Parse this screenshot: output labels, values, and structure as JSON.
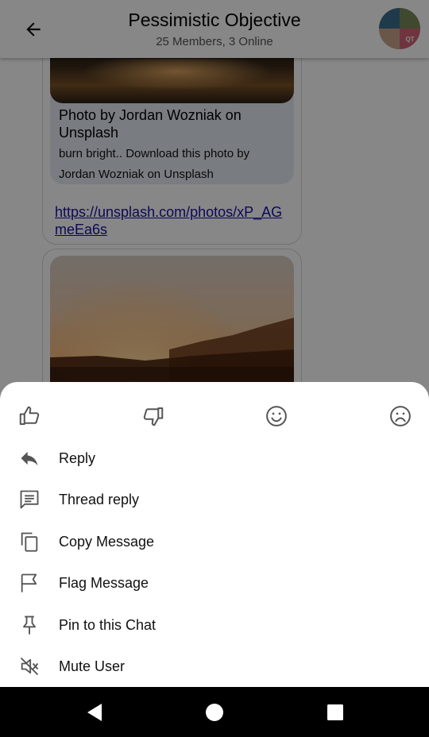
{
  "header": {
    "title": "Pessimistic Objective",
    "subtitle": "25 Members, 3 Online",
    "avatar_initials": "QT"
  },
  "messages": {
    "attachment": {
      "title": "Photo by Jordan Wozniak on Unsplash",
      "text": "burn bright.. Download this photo by Jordan Wozniak on Unsplash"
    },
    "link": "https://unsplash.com/photos/xP_AGmeEa6s"
  },
  "sheet": {
    "reactions": [
      {
        "icon": "thumbs-up-icon"
      },
      {
        "icon": "thumbs-down-icon"
      },
      {
        "icon": "smile-icon"
      },
      {
        "icon": "sad-icon"
      }
    ],
    "actions": [
      {
        "label": "Reply",
        "icon": "reply-icon"
      },
      {
        "label": "Thread reply",
        "icon": "thread-icon"
      },
      {
        "label": "Copy Message",
        "icon": "copy-icon"
      },
      {
        "label": "Flag Message",
        "icon": "flag-icon"
      },
      {
        "label": "Pin to this Chat",
        "icon": "pin-icon"
      },
      {
        "label": "Mute User",
        "icon": "mute-icon"
      }
    ]
  },
  "colors": {
    "icon": "#555555",
    "link": "#1a0dab",
    "card_bg": "#e5ebf3"
  }
}
